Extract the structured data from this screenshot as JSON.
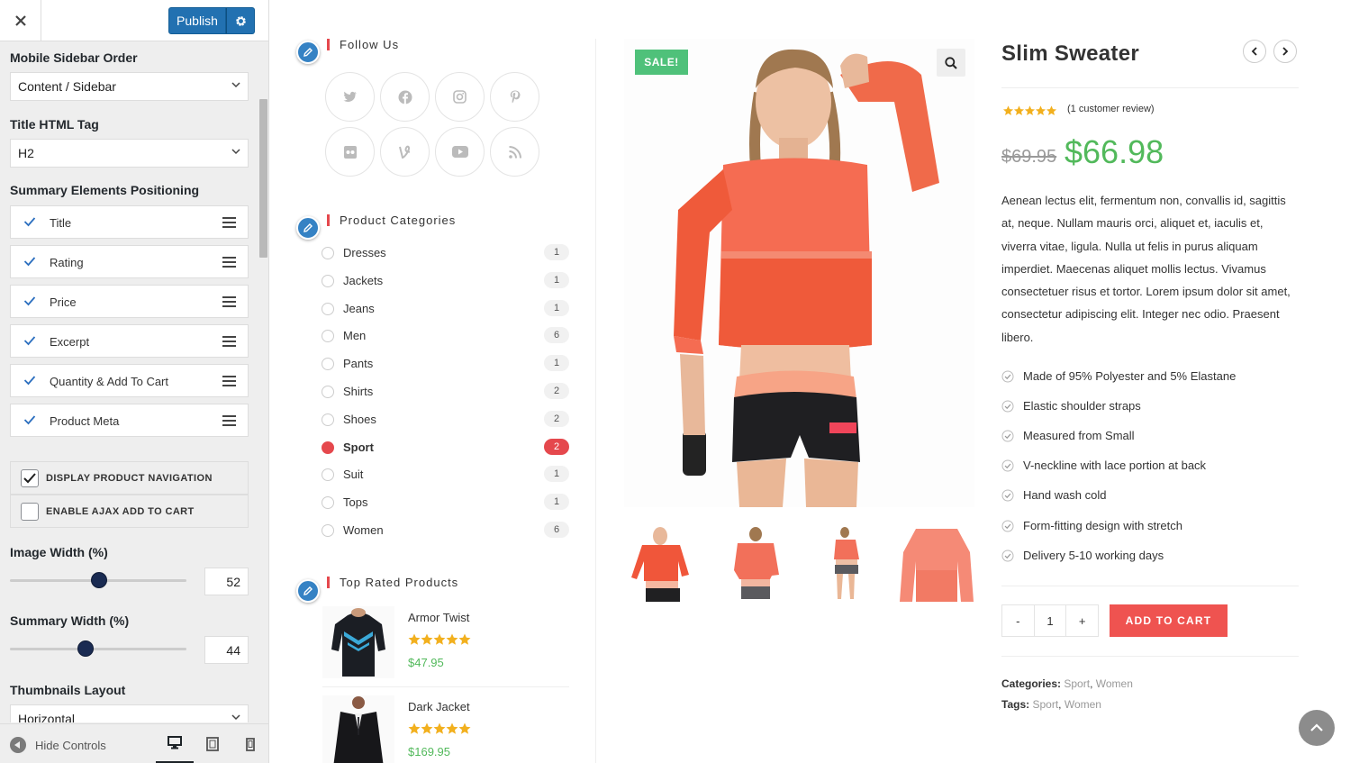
{
  "customizer": {
    "publish_label": "Publish",
    "mobile_sidebar_order": {
      "label": "Mobile Sidebar Order",
      "value": "Content / Sidebar"
    },
    "title_html_tag": {
      "label": "Title HTML Tag",
      "value": "H2"
    },
    "summary_positioning": {
      "label": "Summary Elements Positioning",
      "items": [
        "Title",
        "Rating",
        "Price",
        "Excerpt",
        "Quantity & Add To Cart",
        "Product Meta"
      ]
    },
    "display_product_navigation": {
      "label": "DISPLAY PRODUCT NAVIGATION",
      "checked": true
    },
    "enable_ajax_add_to_cart": {
      "label": "ENABLE AJAX ADD TO CART",
      "checked": false
    },
    "image_width": {
      "label": "Image Width (%)",
      "value": "52"
    },
    "summary_width": {
      "label": "Summary Width (%)",
      "value": "44"
    },
    "thumbnails_layout": {
      "label": "Thumbnails Layout",
      "value": "Horizontal"
    },
    "hide_controls_label": "Hide Controls",
    "accent_color": "#2271b1"
  },
  "sidebar": {
    "follow_us": {
      "title": "Follow Us",
      "icons": [
        "twitter-icon",
        "facebook-icon",
        "instagram-icon",
        "pinterest-icon",
        "flickr-icon",
        "vine-icon",
        "youtube-icon",
        "rss-icon"
      ]
    },
    "product_categories": {
      "title": "Product Categories",
      "items": [
        {
          "name": "Dresses",
          "count": "1"
        },
        {
          "name": "Jackets",
          "count": "1"
        },
        {
          "name": "Jeans",
          "count": "1"
        },
        {
          "name": "Men",
          "count": "6"
        },
        {
          "name": "Pants",
          "count": "1"
        },
        {
          "name": "Shirts",
          "count": "2"
        },
        {
          "name": "Shoes",
          "count": "2"
        },
        {
          "name": "Sport",
          "count": "2"
        },
        {
          "name": "Suit",
          "count": "1"
        },
        {
          "name": "Tops",
          "count": "1"
        },
        {
          "name": "Women",
          "count": "6"
        }
      ],
      "active": "Sport"
    },
    "top_rated": {
      "title": "Top Rated Products",
      "items": [
        {
          "name": "Armor Twist",
          "price": "$47.95",
          "rating": 5
        },
        {
          "name": "Dark Jacket",
          "price": "$169.95",
          "rating": 5
        }
      ]
    }
  },
  "product": {
    "sale_badge": "SALE!",
    "title": "Slim Sweater",
    "rating": 5,
    "review_text": "(1 customer review)",
    "old_price": "$69.95",
    "price": "$66.98",
    "description": "Aenean lectus elit, fermentum non, convallis id, sagittis at, neque. Nullam mauris orci, aliquet et, iaculis et, viverra vitae, ligula. Nulla ut felis in purus aliquam imperdiet. Maecenas aliquet mollis lectus. Vivamus consectetuer risus et tortor. Lorem ipsum dolor sit amet, consectetur adipiscing elit. Integer nec odio. Praesent libero.",
    "features": [
      "Made of 95% Polyester and 5% Elastane",
      "Elastic shoulder straps",
      "Measured from Small",
      "V-neckline with lace portion at back",
      "Hand wash cold",
      "Form-fitting design with stretch",
      "Delivery 5-10 working days"
    ],
    "qty_minus": "-",
    "qty_value": "1",
    "qty_plus": "+",
    "add_to_cart": "ADD TO CART",
    "categories_label": "Categories:",
    "categories": [
      "Sport",
      "Women"
    ],
    "tags_label": "Tags:",
    "tags": [
      "Sport",
      "Women"
    ],
    "price_color": "#52b95b",
    "cart_color": "#ef5350",
    "sale_color": "#4fc17a"
  }
}
